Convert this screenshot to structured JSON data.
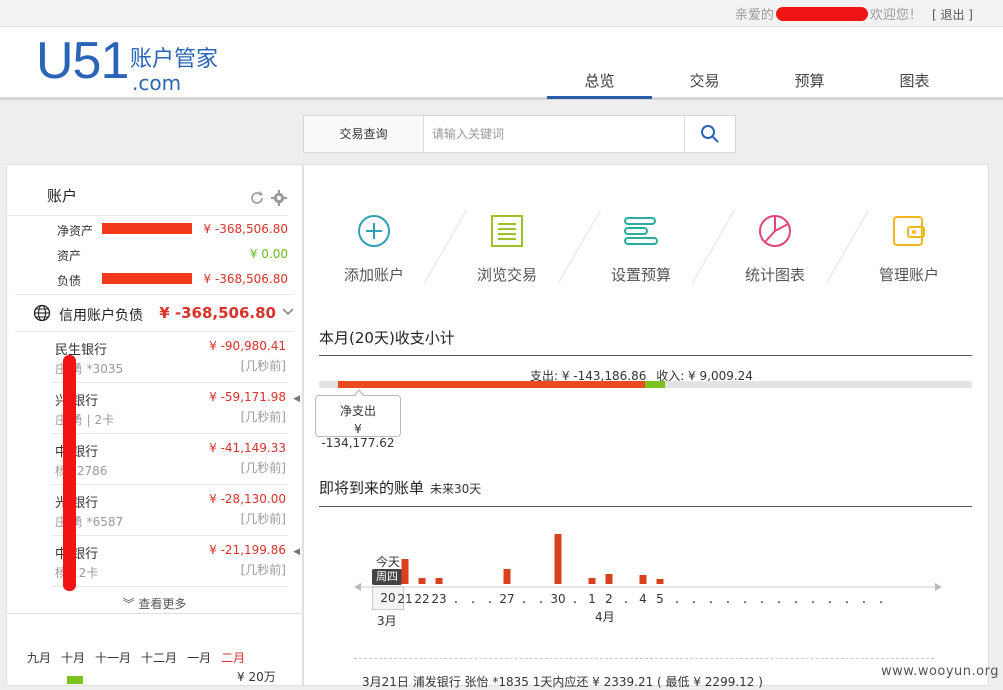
{
  "topbar": {
    "greeting_prefix": "亲爱的",
    "greeting_suffix": "欢迎您！",
    "logout": "[ 退出 ]"
  },
  "logo": {
    "main": "U51",
    "cn": "账户管家",
    "com": ".com"
  },
  "nav": {
    "items": [
      "总览",
      "交易",
      "预算",
      "图表"
    ],
    "active": "总览"
  },
  "search": {
    "label": "交易查询",
    "placeholder": "请输入关键词",
    "icon": "search-icon"
  },
  "accounts": {
    "title": "账户",
    "summary": [
      {
        "label": "净资产",
        "value": "¥ -368,506.80",
        "color": "#d8322a"
      },
      {
        "label": "资产",
        "value": "¥ 0.00",
        "color": "#6cb91f"
      },
      {
        "label": "负债",
        "value": "¥ -368,506.80",
        "color": "#d8322a"
      }
    ],
    "credit": {
      "label": "信用账户负债",
      "value": "¥ -368,506.80"
    },
    "banks": [
      {
        "name": "民生银行",
        "sub": "庄  勇 *3035",
        "amount": "¥ -90,980.41",
        "ago": "[几秒前]",
        "arrow": false
      },
      {
        "name": "兴  银行",
        "sub": "庄  勇 | 2卡",
        "amount": "¥ -59,171.98",
        "ago": "[几秒前]",
        "arrow": true
      },
      {
        "name": "中  银行",
        "sub": "杨   *2786",
        "amount": "¥ -41,149.33",
        "ago": "[几秒前]",
        "arrow": false
      },
      {
        "name": "光  银行",
        "sub": "庄  勇 *6587",
        "amount": "¥ -28,130.00",
        "ago": "[几秒前]",
        "arrow": false
      },
      {
        "name": "中  银行",
        "sub": "杨   | 2卡",
        "amount": "¥ -21,199.86",
        "ago": "[几秒前]",
        "arrow": true
      }
    ],
    "more": "查看更多",
    "months": [
      "九月",
      "十月",
      "十一月",
      "十二月",
      "一月",
      "二月"
    ],
    "active_month": "二月",
    "chart_label": "¥ 20万"
  },
  "quick_actions": [
    {
      "label": "添加账户",
      "icon": "add-circle-icon",
      "color": "#2f9fb6"
    },
    {
      "label": "浏览交易",
      "icon": "list-icon",
      "color": "#9cc326"
    },
    {
      "label": "设置预算",
      "icon": "budget-bars-icon",
      "color": "#2aae9c"
    },
    {
      "label": "统计图表",
      "icon": "pie-chart-icon",
      "color": "#e0457b"
    },
    {
      "label": "管理账户",
      "icon": "wallet-icon",
      "color": "#f2b61e"
    }
  ],
  "monthly": {
    "title": "本月(20天)收支小计",
    "expense_label": "支出: ¥ -143,186.86",
    "income_label": "收入: ¥ 9,009.24",
    "net_label": "净支出",
    "net_value": "¥ -134,177.62"
  },
  "upcoming": {
    "title": "即将到来的账单",
    "subtitle": "未来30天",
    "today_label": "今天",
    "weekday": "周四",
    "day": "20",
    "month_labels": [
      "3月",
      "4月"
    ],
    "bottom_text": "3月21日      浦发银行 张怡 *1835 1天内应还 ¥ 2339.21 ( 最低 ¥ 2299.12 )"
  },
  "watermark": "www.wooyun.org",
  "chart_data": {
    "type": "bar",
    "categories": [
      "20",
      "21",
      "22",
      "23",
      ".",
      ".",
      ".",
      "27",
      ".",
      ".",
      "30",
      ".",
      "1",
      "2",
      ".",
      "4",
      "5",
      ".",
      ".",
      ".",
      ".",
      ".",
      ".",
      ".",
      ".",
      ".",
      ".",
      ".",
      ".",
      "."
    ],
    "values": [
      0,
      25,
      6,
      6,
      0,
      0,
      0,
      15,
      0,
      0,
      50,
      0,
      6,
      10,
      0,
      9,
      5,
      0,
      0,
      0,
      0,
      0,
      0,
      0,
      0,
      0,
      0,
      0,
      0,
      0
    ],
    "title": "",
    "xlabel": "",
    "ylabel": ""
  }
}
